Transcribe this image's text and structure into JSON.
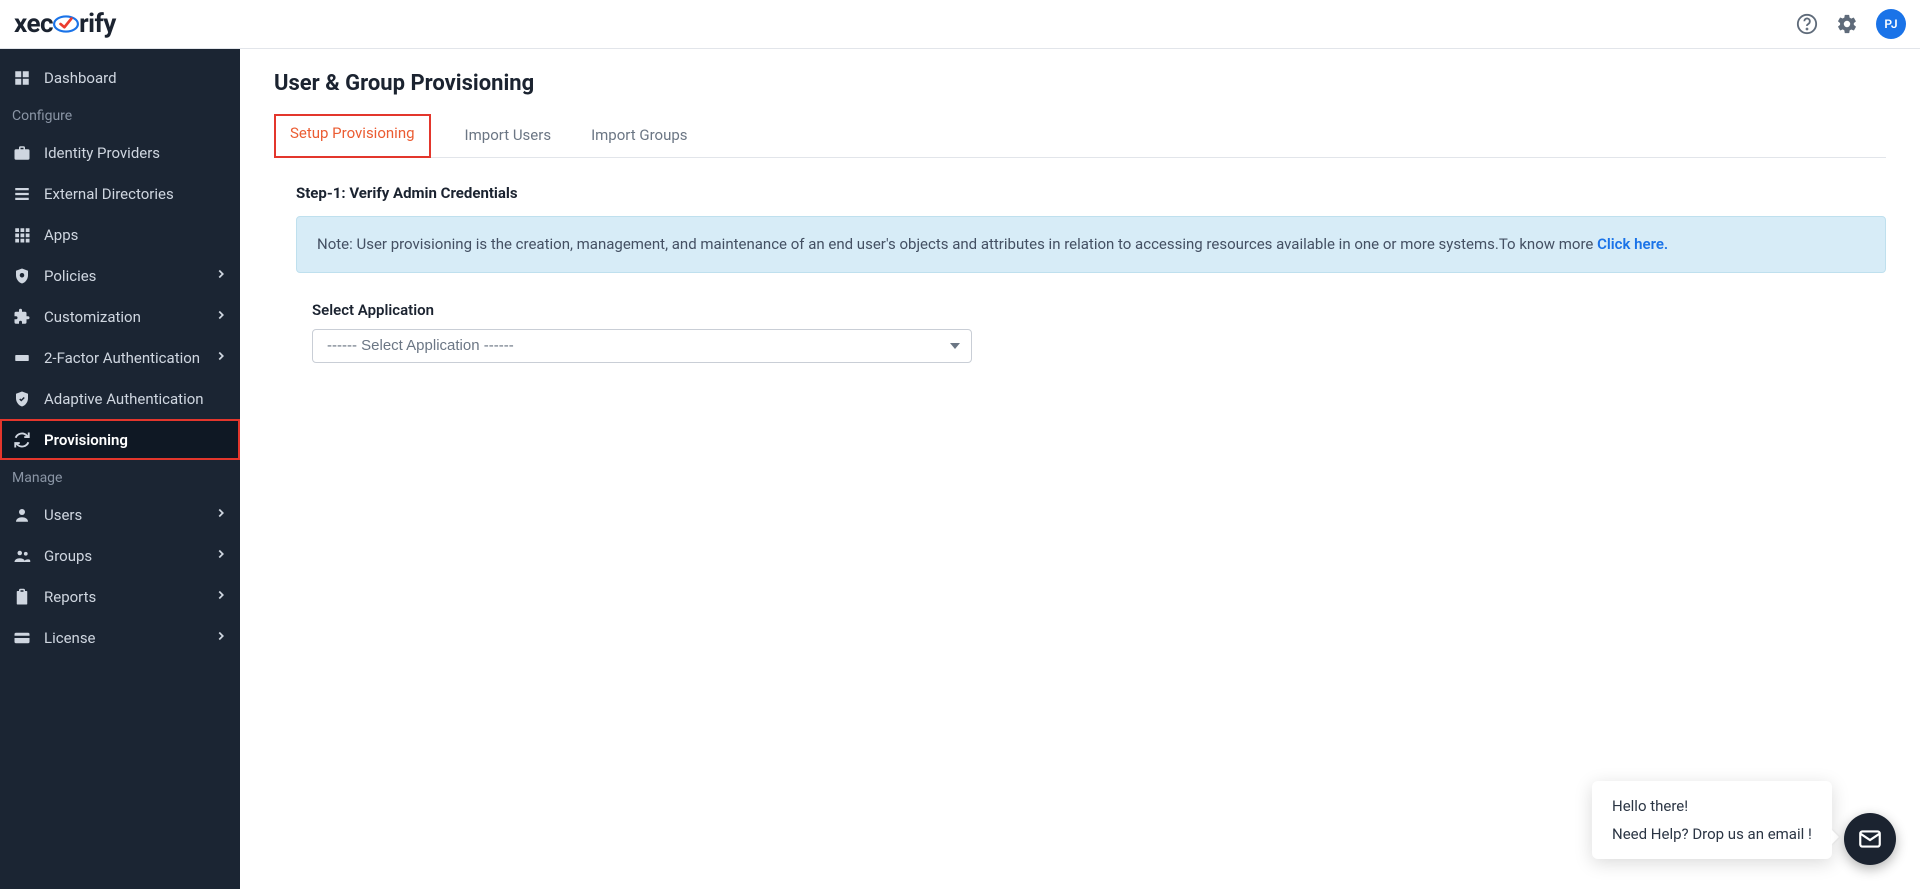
{
  "brand": {
    "name_pre": "xec",
    "name_post": "rify"
  },
  "topbar": {
    "avatar_initials": "PJ"
  },
  "sidebar": {
    "items": [
      {
        "label": "Dashboard"
      }
    ],
    "section_configure": "Configure",
    "configure_items": [
      {
        "label": "Identity Providers",
        "chev": false
      },
      {
        "label": "External Directories",
        "chev": false
      },
      {
        "label": "Apps",
        "chev": false
      },
      {
        "label": "Policies",
        "chev": true
      },
      {
        "label": "Customization",
        "chev": true
      },
      {
        "label": "2-Factor Authentication",
        "chev": true
      },
      {
        "label": "Adaptive Authentication",
        "chev": false
      },
      {
        "label": "Provisioning",
        "chev": false
      }
    ],
    "section_manage": "Manage",
    "manage_items": [
      {
        "label": "Users",
        "chev": true
      },
      {
        "label": "Groups",
        "chev": true
      },
      {
        "label": "Reports",
        "chev": true
      },
      {
        "label": "License",
        "chev": true
      }
    ]
  },
  "main": {
    "title": "User & Group Provisioning",
    "tabs": [
      {
        "label": "Setup Provisioning"
      },
      {
        "label": "Import Users"
      },
      {
        "label": "Import Groups"
      }
    ],
    "step_heading": "Step-1: Verify Admin Credentials",
    "note_text": "Note: User provisioning is the creation, management, and maintenance of an end user's objects and attributes in relation to accessing resources available in one or more systems.To know more ",
    "note_link": "Click here.",
    "select_label": "Select Application",
    "select_placeholder": "------ Select Application ------"
  },
  "chat": {
    "line1": "Hello there!",
    "line2": "Need Help? Drop us an email !"
  }
}
